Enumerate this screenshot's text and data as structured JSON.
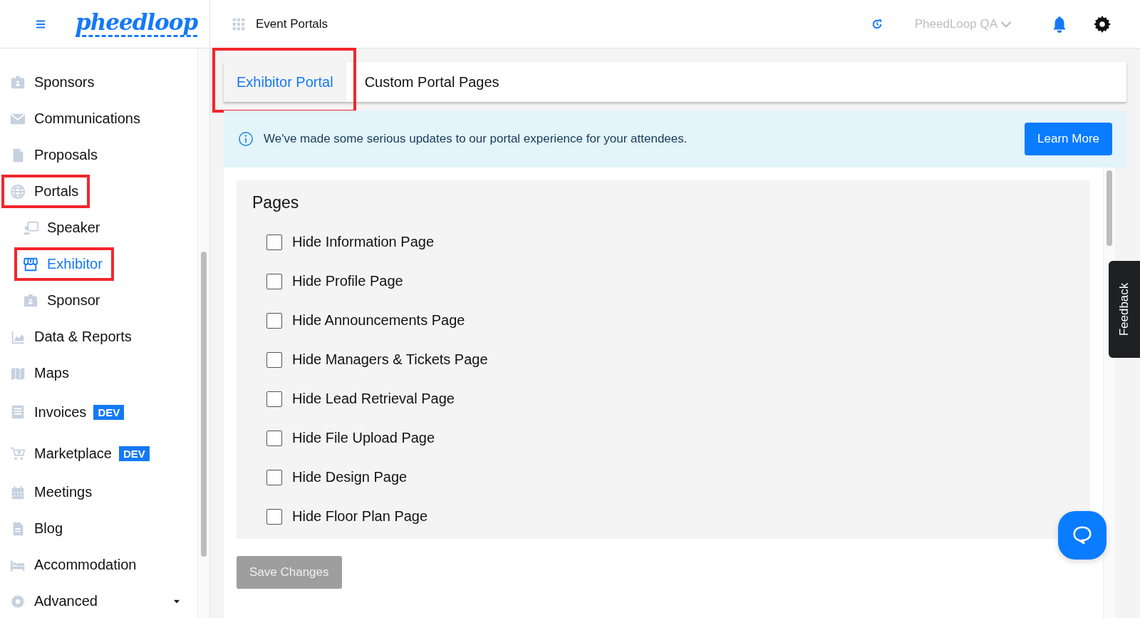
{
  "header": {
    "logo": "pheedloop",
    "page_title": "Event Portals",
    "account": "PheedLoop QA"
  },
  "sidebar": {
    "items": [
      {
        "label": "Sponsors",
        "selected": false,
        "highlighted": false
      },
      {
        "label": "Communications",
        "selected": false,
        "highlighted": false
      },
      {
        "label": "Proposals",
        "selected": false,
        "highlighted": false
      },
      {
        "label": "Portals",
        "selected": false,
        "highlighted": true,
        "expanded": true,
        "children": [
          {
            "label": "Speaker",
            "selected": false,
            "highlighted": false
          },
          {
            "label": "Exhibitor",
            "selected": true,
            "highlighted": true
          },
          {
            "label": "Sponsor",
            "selected": false,
            "highlighted": false
          }
        ]
      },
      {
        "label": "Data & Reports",
        "selected": false,
        "highlighted": false
      },
      {
        "label": "Maps",
        "selected": false,
        "highlighted": false
      },
      {
        "label": "Invoices",
        "selected": false,
        "highlighted": false,
        "badge": "DEV"
      },
      {
        "label": "Marketplace",
        "selected": false,
        "highlighted": false,
        "badge": "DEV"
      },
      {
        "label": "Meetings",
        "selected": false,
        "highlighted": false
      },
      {
        "label": "Blog",
        "selected": false,
        "highlighted": false
      },
      {
        "label": "Accommodation",
        "selected": false,
        "highlighted": false
      },
      {
        "label": "Advanced",
        "selected": false,
        "highlighted": false,
        "expanded": false
      }
    ]
  },
  "tabs": [
    {
      "label": "Exhibitor Portal",
      "selected": true,
      "highlighted": true
    },
    {
      "label": "Custom Portal Pages",
      "selected": false,
      "highlighted": false
    }
  ],
  "banner": {
    "message": "We've made some serious updates to our portal experience for your attendees.",
    "button": "Learn More"
  },
  "pages": {
    "title": "Pages",
    "options": [
      {
        "label": "Hide Information Page",
        "checked": false
      },
      {
        "label": "Hide Profile Page",
        "checked": false
      },
      {
        "label": "Hide Announcements Page",
        "checked": false
      },
      {
        "label": "Hide Managers & Tickets Page",
        "checked": false
      },
      {
        "label": "Hide Lead Retrieval Page",
        "checked": false
      },
      {
        "label": "Hide File Upload Page",
        "checked": false
      },
      {
        "label": "Hide Design Page",
        "checked": false
      },
      {
        "label": "Hide Floor Plan Page",
        "checked": false
      }
    ]
  },
  "save_button": {
    "label": "Save Changes",
    "disabled": true
  },
  "feedback_tab": "Feedback"
}
